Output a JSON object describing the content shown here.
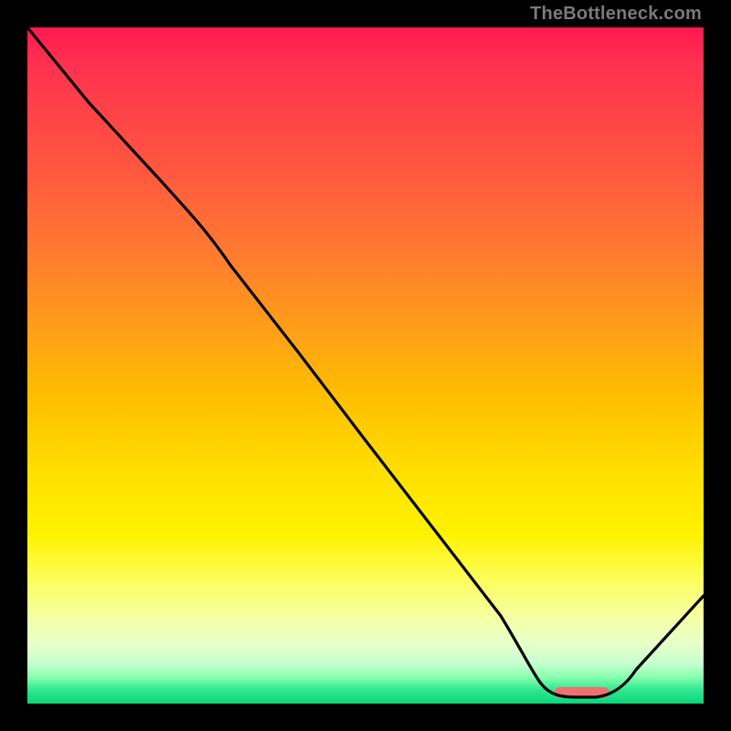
{
  "watermark": "TheBottleneck.com",
  "gradient_stops": [
    {
      "pct": 0,
      "color": "#ff1850"
    },
    {
      "pct": 5,
      "color": "#ff3050"
    },
    {
      "pct": 22,
      "color": "#ff5a3f"
    },
    {
      "pct": 33,
      "color": "#ff7a30"
    },
    {
      "pct": 45,
      "color": "#ffa018"
    },
    {
      "pct": 55,
      "color": "#ffc000"
    },
    {
      "pct": 66,
      "color": "#ffe000"
    },
    {
      "pct": 75,
      "color": "#fff200"
    },
    {
      "pct": 82,
      "color": "#fcff60"
    },
    {
      "pct": 87,
      "color": "#f6ffa0"
    },
    {
      "pct": 91,
      "color": "#e8ffc8"
    },
    {
      "pct": 94,
      "color": "#c8ffd0"
    },
    {
      "pct": 96,
      "color": "#8affb0"
    },
    {
      "pct": 98,
      "color": "#30e890"
    },
    {
      "pct": 100,
      "color": "#08d878"
    }
  ],
  "chart_data": {
    "type": "line",
    "title": "",
    "xlabel": "",
    "ylabel": "",
    "xlim": [
      0,
      100
    ],
    "ylim": [
      0,
      100
    ],
    "series": [
      {
        "name": "curve",
        "color": "#000000",
        "x": [
          0,
          9,
          20,
          30,
          40,
          50,
          60,
          70,
          76,
          80,
          84,
          90,
          100
        ],
        "y": [
          100,
          89,
          77,
          65,
          52,
          39,
          26,
          13,
          3,
          1,
          1,
          5,
          16
        ]
      }
    ],
    "marker": {
      "name": "highlight-band",
      "color": "#f07070",
      "x_start": 78,
      "x_end": 86,
      "y": 1,
      "thickness_pct": 1.5
    }
  }
}
